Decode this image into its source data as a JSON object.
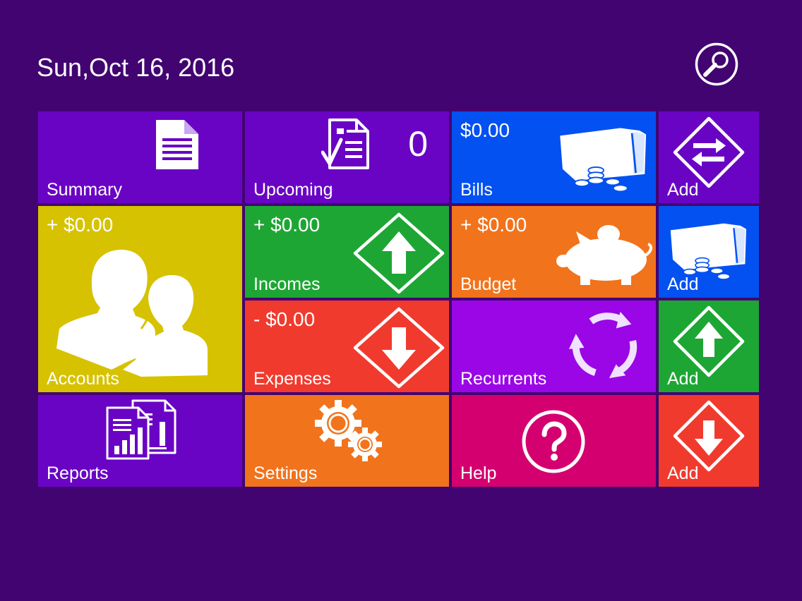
{
  "header": {
    "date": "Sun,Oct 16, 2016",
    "search_icon": "search-icon"
  },
  "colors": {
    "background": "#420471",
    "purple": "#6a04c4",
    "blue": "#0351f1",
    "yellow": "#d6c200",
    "green": "#1ea634",
    "orange": "#f1731c",
    "red": "#f13a2e",
    "magenta": "#d4006f"
  },
  "tiles": {
    "summary": {
      "label": "Summary",
      "icon": "document-icon"
    },
    "upcoming": {
      "label": "Upcoming",
      "count": "0",
      "icon": "checklist-icon"
    },
    "bills": {
      "label": "Bills",
      "amount": "$0.00",
      "icon": "wallet-coins-icon"
    },
    "add_transfer": {
      "label": "Add",
      "icon": "transfer-arrows-icon"
    },
    "accounts": {
      "label": "Accounts",
      "amount": "+ $0.00",
      "icon": "people-icon"
    },
    "incomes": {
      "label": "Incomes",
      "amount": "+ $0.00",
      "icon": "arrow-up-icon"
    },
    "budget": {
      "label": "Budget",
      "amount": "+ $0.00",
      "icon": "piggy-bank-icon"
    },
    "add_bill": {
      "label": "Add",
      "icon": "wallet-coins-icon"
    },
    "expenses": {
      "label": "Expenses",
      "amount": "- $0.00",
      "icon": "arrow-down-icon"
    },
    "recurrents": {
      "label": "Recurrents",
      "icon": "cycle-arrows-icon"
    },
    "add_income": {
      "label": "Add",
      "icon": "arrow-up-icon"
    },
    "reports": {
      "label": "Reports",
      "icon": "report-charts-icon"
    },
    "settings": {
      "label": "Settings",
      "icon": "gears-icon"
    },
    "help": {
      "label": "Help",
      "icon": "question-icon"
    },
    "add_expense": {
      "label": "Add",
      "icon": "arrow-down-icon"
    }
  }
}
